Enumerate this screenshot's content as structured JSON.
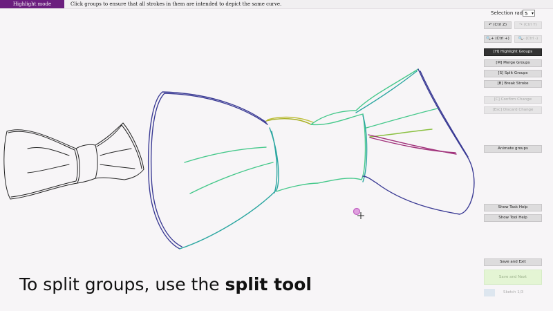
{
  "topbar": {
    "mode_label": "Highlight mode",
    "instruction": "Click groups to ensure that all strokes in them are intended to depict the same curve."
  },
  "panel": {
    "selection_radius_label": "Selection radius:",
    "selection_radius_value": "5",
    "undo_label": "↶ (Ctrl Z)",
    "redo_label": "↷ (Ctrl Y)",
    "zoom_in_label": "🔍+ (Ctrl +)",
    "zoom_out_label": "🔍- (Ctrl -)",
    "highlight_groups_label": "[H] Highlight Groups",
    "merge_groups_label": "[M] Merge Groups",
    "split_groups_label": "[S] Split Groups",
    "break_stroke_label": "[B] Break Stroke",
    "confirm_change_label": "[C] Confirm Change",
    "discard_change_label": "[Esc] Discard Change",
    "animate_groups_label": "Animate groups",
    "show_task_help_label": "Show Task Help",
    "show_tool_help_label": "Show Tool Help",
    "save_exit_label": "Save and Exit",
    "save_next_label": "Save and Next",
    "sketch_counter": "Sketch 1/3"
  },
  "caption": {
    "prefix": "To split groups, use the ",
    "emphasis": "split tool"
  },
  "colors": {
    "mode_badge": "#6b1e7e",
    "active_button": "#333333",
    "stroke_navy": "#3a3a94",
    "stroke_teal": "#2aa6a0",
    "stroke_green": "#44c88a",
    "stroke_yellow": "#a8b020",
    "stroke_magenta": "#a0307a",
    "cursor": "#c060c0"
  }
}
